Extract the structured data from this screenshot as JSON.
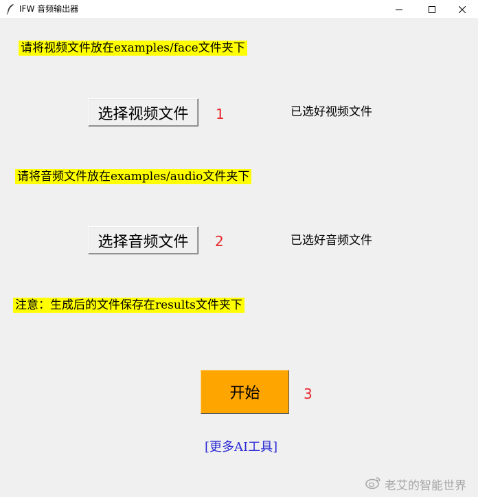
{
  "window": {
    "title": "IFW 音频输出器",
    "icon": "feather-icon",
    "controls": {
      "minimize": "minimize-icon",
      "maximize": "maximize-icon",
      "close": "close-icon"
    }
  },
  "video_section": {
    "notice": "请将视频文件放在examples/face文件夹下",
    "button_label": "选择视频文件",
    "step": "1",
    "status": "已选好视频文件"
  },
  "audio_section": {
    "notice": "请将音频文件放在examples/audio文件夹下",
    "button_label": "选择音频文件",
    "step": "2",
    "status": "已选好音频文件"
  },
  "output_notice": "注意：生成后的文件保存在results文件夹下",
  "start": {
    "label": "开始",
    "step": "3"
  },
  "more_tools_link": "[更多AI工具]",
  "watermark": {
    "text": "老艾的智能世界",
    "icon": "weibo-icon"
  },
  "colors": {
    "window_bg": "#f0f0f0",
    "notice_bg": "#ffff00",
    "start_button_bg": "#ffa500",
    "step_number": "#e8242a",
    "link": "#2b2bd6"
  }
}
